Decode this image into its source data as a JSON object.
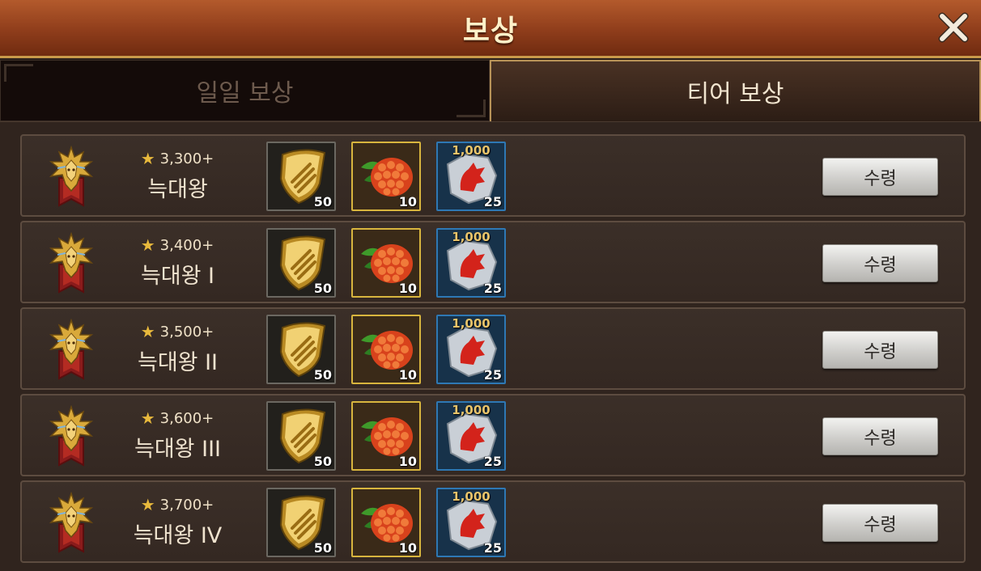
{
  "header": {
    "title": "보상"
  },
  "tabs": [
    {
      "label": "일일 보상",
      "active": false
    },
    {
      "label": "티어 보상",
      "active": true
    }
  ],
  "rewards": [
    {
      "requirement": "3,300+",
      "tier": "늑대왕",
      "items": [
        {
          "name": "shield",
          "qty": "50"
        },
        {
          "name": "berry",
          "qty": "10"
        },
        {
          "name": "fragment",
          "qty": "25",
          "label": "1,000"
        }
      ],
      "button": "수령"
    },
    {
      "requirement": "3,400+",
      "tier": "늑대왕 I",
      "items": [
        {
          "name": "shield",
          "qty": "50"
        },
        {
          "name": "berry",
          "qty": "10"
        },
        {
          "name": "fragment",
          "qty": "25",
          "label": "1,000"
        }
      ],
      "button": "수령"
    },
    {
      "requirement": "3,500+",
      "tier": "늑대왕 II",
      "items": [
        {
          "name": "shield",
          "qty": "50"
        },
        {
          "name": "berry",
          "qty": "10"
        },
        {
          "name": "fragment",
          "qty": "25",
          "label": "1,000"
        }
      ],
      "button": "수령"
    },
    {
      "requirement": "3,600+",
      "tier": "늑대왕 III",
      "items": [
        {
          "name": "shield",
          "qty": "50"
        },
        {
          "name": "berry",
          "qty": "10"
        },
        {
          "name": "fragment",
          "qty": "25",
          "label": "1,000"
        }
      ],
      "button": "수령"
    },
    {
      "requirement": "3,700+",
      "tier": "늑대왕 IV",
      "items": [
        {
          "name": "shield",
          "qty": "50"
        },
        {
          "name": "berry",
          "qty": "10"
        },
        {
          "name": "fragment",
          "qty": "25",
          "label": "1,000"
        }
      ],
      "button": "수령"
    }
  ],
  "icons": {
    "close": "close-icon",
    "star": "star-icon",
    "emblem": "wolf-king-emblem-icon",
    "shield": "gold-shield-icon",
    "berry": "red-berry-icon",
    "fragment": "wolf-fragment-icon"
  },
  "colors": {
    "header": "#9a4420",
    "claim_button": "#d6d5d1",
    "active_tab_border": "#b89358"
  }
}
